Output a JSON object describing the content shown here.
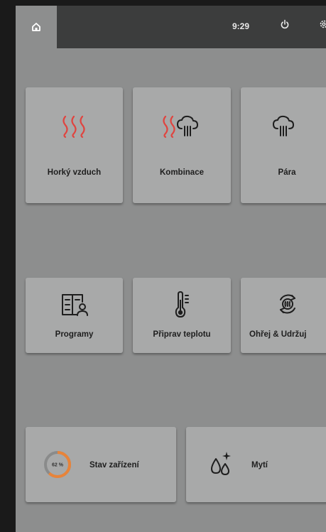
{
  "status_bar": {
    "time": "9:29",
    "home_icon": "home-icon",
    "power_icon": "power-icon",
    "settings_icon": "gear-icon"
  },
  "modes": [
    {
      "label": "Horký vzduch",
      "icon": "hot-air-icon"
    },
    {
      "label": "Kombinace",
      "icon": "combination-icon"
    },
    {
      "label": "Pára",
      "icon": "steam-icon"
    }
  ],
  "functions": [
    {
      "label": "Programy",
      "icon": "programs-icon"
    },
    {
      "label": "Připrav teplotu",
      "icon": "thermometer-icon"
    },
    {
      "label": "Ohřej & Udržuj",
      "icon": "reheat-icon"
    }
  ],
  "device": {
    "status_label": "Stav zařízení",
    "status_percent": "62 %",
    "status_fraction": 0.62,
    "cleaning_label": "Mytí",
    "cleaning_icon": "cleaning-drops-icon"
  },
  "colors": {
    "accent_red": "#e0443f",
    "gauge_orange": "#e8843a"
  }
}
